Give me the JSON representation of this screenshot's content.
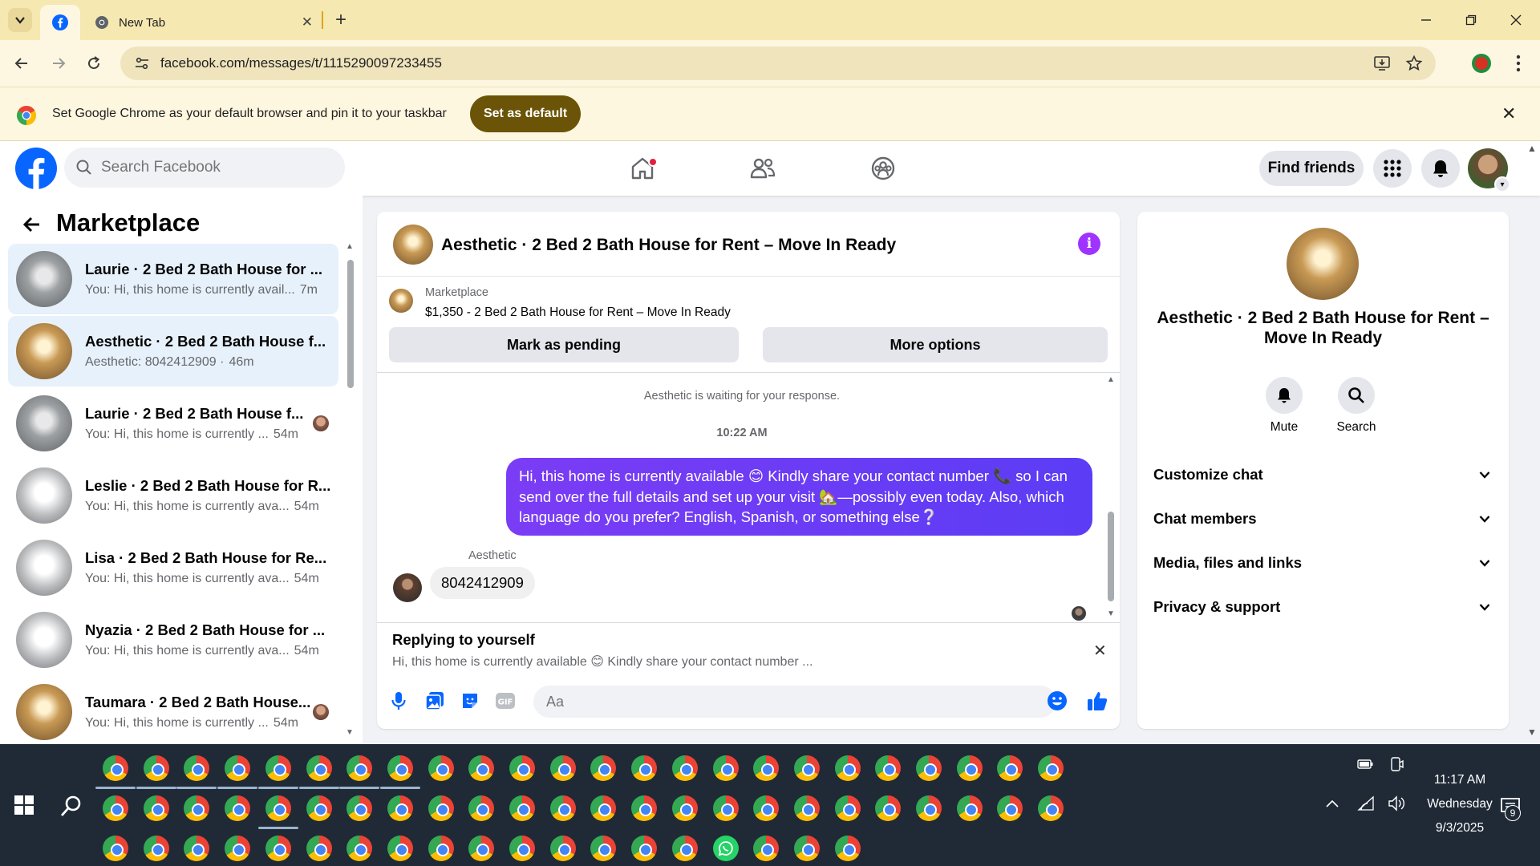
{
  "browser": {
    "active_tab_icon": "facebook-icon",
    "inactive_tab_title": "New Tab",
    "url": "facebook.com/messages/t/1115290097233455"
  },
  "infobar": {
    "text": "Set Google Chrome as your default browser and pin it to your taskbar",
    "button_label": "Set as default"
  },
  "fb_header": {
    "search_placeholder": "Search Facebook",
    "find_friends_label": "Find friends"
  },
  "sidebar": {
    "title": "Marketplace",
    "conversations": [
      {
        "name": "Laurie · 2 Bed 2 Bath House for ...",
        "preview": "You: Hi, this home is currently avail...",
        "time": "7m",
        "thumb": "grey",
        "active": true,
        "read": false
      },
      {
        "name": "Aesthetic · 2 Bed 2 Bath House f...",
        "preview": "Aesthetic: 8042412909 ·",
        "time": "46m",
        "thumb": "gold",
        "active": true,
        "read": false
      },
      {
        "name": "Laurie · 2 Bed 2 Bath House f...",
        "preview": "You: Hi, this home is currently ...",
        "time": "54m",
        "thumb": "grey",
        "active": false,
        "read": true
      },
      {
        "name": "Leslie · 2 Bed 2 Bath House for R...",
        "preview": "You: Hi, this home is currently ava...",
        "time": "54m",
        "thumb": "white",
        "active": false,
        "read": false
      },
      {
        "name": "Lisa · 2 Bed 2 Bath House for Re...",
        "preview": "You: Hi, this home is currently ava...",
        "time": "54m",
        "thumb": "white",
        "active": false,
        "read": false
      },
      {
        "name": "Nyazia · 2 Bed 2 Bath House for ...",
        "preview": "You: Hi, this home is currently ava...",
        "time": "54m",
        "thumb": "white",
        "active": false,
        "read": false
      },
      {
        "name": "Taumara · 2 Bed 2 Bath House...",
        "preview": "You: Hi, this home is currently ...",
        "time": "54m",
        "thumb": "gold",
        "active": false,
        "read": true
      }
    ]
  },
  "chat": {
    "title": "Aesthetic · 2 Bed 2 Bath House for Rent – Move In Ready",
    "listing_source": "Marketplace",
    "listing_price": "$1,350 - 2 Bed 2 Bath House for Rent – Move In Ready",
    "mark_pending_label": "Mark as pending",
    "more_options_label": "More options",
    "waiting_text": "Aesthetic is waiting for your response.",
    "time_divider": "10:22 AM",
    "outgoing_message": "Hi, this home is currently available 😊 Kindly share your contact number 📞 so I can send over the full details and set up your visit 🏡—possibly even today. Also, which language do you prefer? English, Spanish, or something else❔",
    "incoming_sender": "Aesthetic",
    "incoming_message": "8042412909",
    "reply_title": "Replying to yourself",
    "reply_preview": "Hi, this home is currently available 😊 Kindly share your contact number ...",
    "composer_placeholder": "Aa"
  },
  "info_panel": {
    "title": "Aesthetic · 2 Bed 2 Bath House for Rent – Move In Ready",
    "mute_label": "Mute",
    "search_label": "Search",
    "sections": [
      "Customize chat",
      "Chat members",
      "Media, files and links",
      "Privacy & support"
    ]
  },
  "taskbar": {
    "time": "11:17 AM",
    "day": "Wednesday",
    "date": "9/3/2025",
    "notification_count": "9"
  },
  "colors": {
    "fb_blue": "#0866ff",
    "outgoing_bubble": "#6a3cf5",
    "info_purple": "#a033ff",
    "chrome_tab_strip": "#f6e8b1",
    "set_default_button": "#6b5407"
  }
}
